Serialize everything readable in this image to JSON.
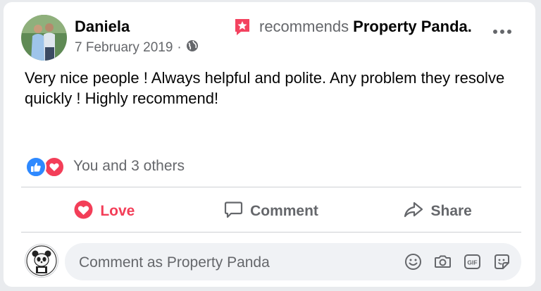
{
  "post": {
    "author": "Daniela",
    "date": "7 February 2019",
    "date_separator": "·",
    "recommends_text": "recommends",
    "page_name": "Property Panda.",
    "body": "Very nice people ! Always helpful and polite. Any problem they resolve quickly ! Highly recommend!"
  },
  "reactions": {
    "summary": "You and 3 others",
    "types": [
      "like",
      "love"
    ]
  },
  "actions": {
    "love": "Love",
    "comment": "Comment",
    "share": "Share"
  },
  "comment": {
    "placeholder": "Comment as Property Panda"
  },
  "icons": {
    "recommend": "recommend-star-flag-icon",
    "privacy": "globe-icon",
    "more": "more-dots-icon",
    "like": "like-thumb-icon",
    "love": "love-heart-icon",
    "comment": "comment-bubble-icon",
    "share": "share-arrow-icon",
    "emoji": "emoji-icon",
    "camera": "camera-icon",
    "gif": "gif-icon",
    "sticker": "sticker-icon"
  },
  "colors": {
    "accent_blue": "#2e89ff",
    "love_red": "#f33e58",
    "recommend_red": "#f3425f",
    "muted_text": "#65676b"
  }
}
